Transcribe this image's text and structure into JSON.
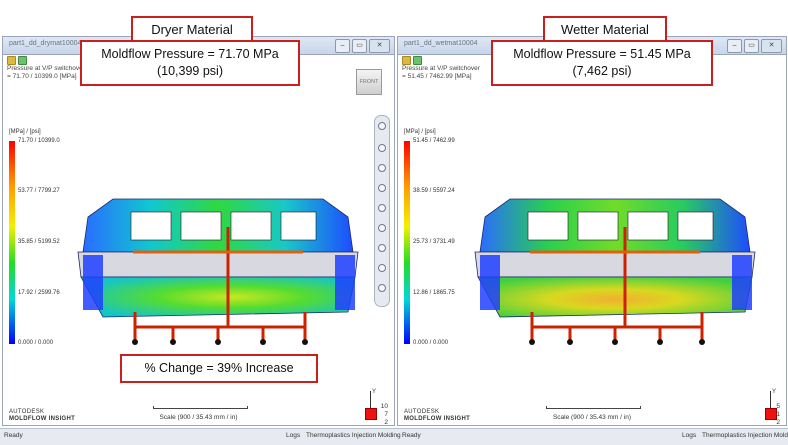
{
  "left": {
    "caption": "Dryer Material",
    "window_title": "part1_dd_drymat10004",
    "result_title": "Pressure at V/P switchover",
    "result_range": "= 71.70 / 10399.0 [MPa]",
    "unit_label": "[MPa] / [psi]",
    "ticks": [
      "71.70 / 10399.0",
      "53.77 / 7799.27",
      "35.85 / 5199.52",
      "17.92 / 2599.76",
      "0.000 / 0.000"
    ],
    "pressure_line1": "Moldflow Pressure = 71.70 MPa",
    "pressure_line2": "(10,399 psi)",
    "change_text": "% Change = 39% Increase",
    "scale_text": "Scale (900 / 35.43 mm / in)",
    "brand_line1": "AUTODESK",
    "brand_line2": "MOLDFLOW INSIGHT",
    "front_label": "FRONT",
    "side_nums": [
      "10",
      "7",
      "2"
    ],
    "axis_label": "Y"
  },
  "right": {
    "caption": "Wetter Material",
    "window_title": "part1_dd_wetmat10004",
    "result_title": "Pressure at V/P switchover",
    "result_range": "= 51.45 / 7462.99 [MPa]",
    "unit_label": "[MPa] / [psi]",
    "ticks": [
      "51.45 / 7462.99",
      "38.59 / 5597.24",
      "25.73 / 3731.49",
      "12.86 / 1865.75",
      "0.000 / 0.000"
    ],
    "pressure_line1": "Moldflow Pressure = 51.45 MPa",
    "pressure_line2": "(7,462 psi)",
    "scale_text": "Scale (900 / 35.43 mm / in)",
    "brand_line1": "AUTODESK",
    "brand_line2": "MOLDFLOW INSIGHT",
    "side_nums": [
      "5",
      "1",
      "2"
    ],
    "axis_label": "Y"
  },
  "status": {
    "ready": "Ready",
    "logs": "Logs",
    "analysis": "Thermoplastics Injection Molding"
  },
  "window_buttons": {
    "minimize": "–",
    "restore": "▭",
    "close": "✕"
  },
  "colors": {
    "callout_border": "#c8201c",
    "cold": "#0000ff",
    "hot": "#ff0000"
  }
}
